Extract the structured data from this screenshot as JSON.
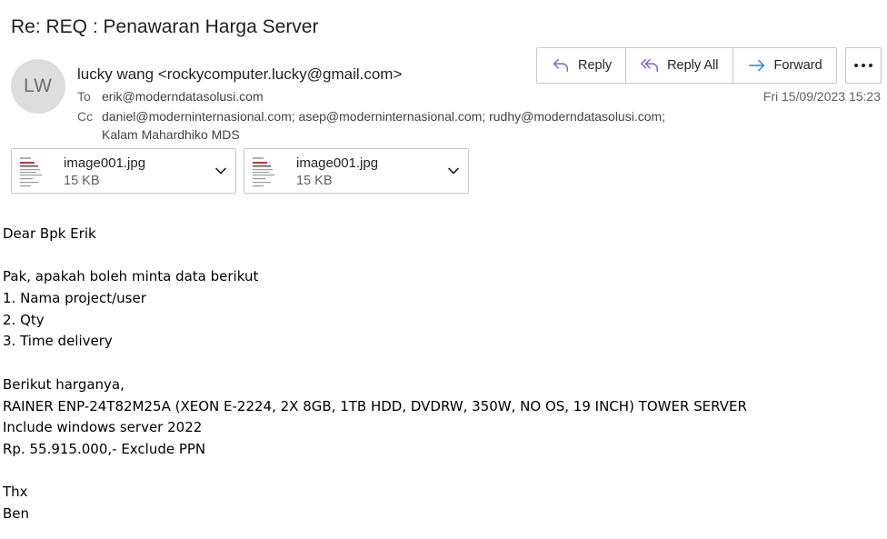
{
  "email": {
    "subject": "Re: REQ : Penawaran Harga Server",
    "avatar_initials": "LW",
    "from": "lucky wang <rockycomputer.lucky@gmail.com>",
    "to_label": "To",
    "to": "erik@moderndatasolusi.com",
    "cc_label": "Cc",
    "cc_line1": "daniel@moderninternasional.com; asep@moderninternasional.com; rudhy@moderndatasolusi.com;",
    "cc_line2": "Kalam Mahardhiko MDS",
    "date": "Fri 15/09/2023 15:23"
  },
  "actions": {
    "reply": "Reply",
    "reply_all": "Reply All",
    "forward": "Forward",
    "more_icon": "ellipsis-icon"
  },
  "colors": {
    "action_icon": "#8a5fc6",
    "forward_icon": "#2f7fd1",
    "avatar_bg": "#dddddd"
  },
  "attachments": [
    {
      "name": "image001.jpg",
      "size": "15 KB"
    },
    {
      "name": "image001.jpg",
      "size": "15 KB"
    }
  ],
  "body_lines": [
    "Dear Bpk Erik",
    "",
    "Pak, apakah boleh minta data berikut",
    "1. Nama project/user",
    "2. Qty",
    "3. Time delivery",
    "",
    "Berikut harganya,",
    "RAINER ENP-24T82M25A (XEON E-2224, 2X 8GB, 1TB HDD, DVDRW, 350W, NO OS, 19 INCH) TOWER SERVER",
    "Include windows server 2022",
    "Rp. 55.915.000,- Exclude PPN",
    "",
    "Thx",
    "Ben"
  ]
}
